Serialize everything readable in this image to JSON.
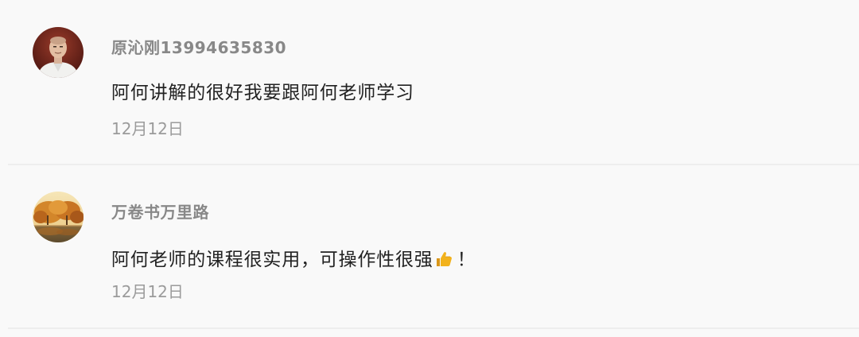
{
  "comments": [
    {
      "username": "原沁刚13994635830",
      "text": "阿何讲解的很好我要跟阿何老师学习",
      "date": "12月12日",
      "avatar_icon": "person-portrait-icon"
    },
    {
      "username": "万卷书万里路",
      "text_before_emoji": "阿何老师的课程很实用，可操作性很强",
      "emoji_icon": "thumbs-up-icon",
      "text_after_emoji": "！",
      "date": "12月12日",
      "avatar_icon": "autumn-tree-landscape-icon"
    }
  ],
  "colors": {
    "background": "#f9f9f9",
    "username": "#888888",
    "text": "#222222",
    "date": "#9b9b9b",
    "divider": "#eeeeee",
    "thumb": "#f2b21c"
  }
}
